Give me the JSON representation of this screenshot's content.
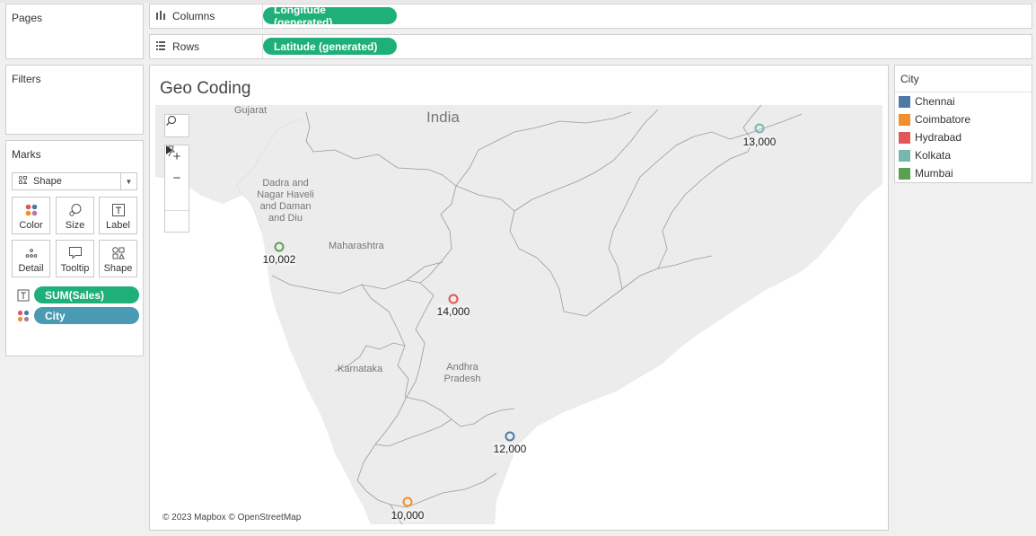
{
  "panels": {
    "pages": "Pages",
    "filters": "Filters",
    "marks": "Marks"
  },
  "marks": {
    "mark_type": "Shape",
    "buttons": {
      "color": "Color",
      "size": "Size",
      "label": "Label",
      "detail": "Detail",
      "tooltip": "Tooltip",
      "shape": "Shape"
    },
    "fields": [
      {
        "name": "SUM(Sales)",
        "type": "label"
      },
      {
        "name": "City",
        "type": "color"
      }
    ]
  },
  "shelves": {
    "columns": {
      "label": "Columns",
      "pill": "Longitude (generated)"
    },
    "rows": {
      "label": "Rows",
      "pill": "Latitude (generated)"
    }
  },
  "viz": {
    "title": "Geo Coding",
    "attribution": "© 2023 Mapbox © OpenStreetMap",
    "map_labels": {
      "gujarat": "Gujarat",
      "india": "India",
      "dadra_l1": "Dadra and",
      "dadra_l2": "Nagar Haveli",
      "dadra_l3": "and Daman",
      "dadra_l4": "and Diu",
      "maharashtra": "Maharashtra",
      "karnataka": "Karnataka",
      "andhra_l1": "Andhra",
      "andhra_l2": "Pradesh"
    },
    "points": [
      {
        "city": "Mumbai",
        "sales": "10,002",
        "color": "#59a14f"
      },
      {
        "city": "Hydrabad",
        "sales": "14,000",
        "color": "#e15759"
      },
      {
        "city": "Kolkata",
        "sales": "13,000",
        "color": "#76b7b2"
      },
      {
        "city": "Chennai",
        "sales": "12,000",
        "color": "#4e79a7"
      },
      {
        "city": "Coimbatore",
        "sales": "10,000",
        "color": "#f28e2b"
      }
    ]
  },
  "legend": {
    "title": "City",
    "items": [
      {
        "label": "Chennai",
        "color": "#4e79a7"
      },
      {
        "label": "Coimbatore",
        "color": "#f28e2b"
      },
      {
        "label": "Hydrabad",
        "color": "#e15759"
      },
      {
        "label": "Kolkata",
        "color": "#76b7b2"
      },
      {
        "label": "Mumbai",
        "color": "#59a14f"
      }
    ]
  }
}
